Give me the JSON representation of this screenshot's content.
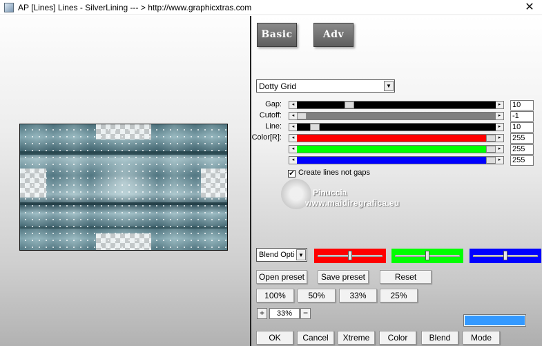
{
  "window": {
    "title": "AP [Lines]  Lines - SilverLining     --- > http://www.graphicxtras.com",
    "close_glyph": "✕"
  },
  "modes": {
    "basic_label": "Basic",
    "adv_label": "Adv"
  },
  "type_select": {
    "value": "Dotty Grid"
  },
  "sliders": [
    {
      "label": "Gap:",
      "value": "10",
      "color": "#000000",
      "fill": 0.25
    },
    {
      "label": "Cutoff:",
      "value": "-1",
      "color": "#808080",
      "fill": 0.0
    },
    {
      "label": "Line:",
      "value": "10",
      "color": "#000000",
      "fill": 0.07
    },
    {
      "label": "Color[R]:",
      "value": "255",
      "color": "#ff0000",
      "fill": 1.0
    },
    {
      "label": "",
      "value": "255",
      "color": "#00ff00",
      "fill": 1.0
    },
    {
      "label": "",
      "value": "255",
      "color": "#0000ff",
      "fill": 1.0
    }
  ],
  "checkbox": {
    "label": "Create lines not gaps",
    "checked": true
  },
  "watermark": {
    "name": "Pinuccia",
    "site": "www.maidiregrafica.eu"
  },
  "blend": {
    "select_value": "Blend Optic",
    "red_color": "#ff0000",
    "green_color": "#00ff00",
    "blue_color": "#0000ff",
    "red_level": 0.5,
    "green_level": 0.5,
    "blue_level": 0.5
  },
  "presets": {
    "open_label": "Open preset",
    "save_label": "Save preset",
    "reset_label": "Reset"
  },
  "zoom_buttons": [
    "100%",
    "50%",
    "33%",
    "25%"
  ],
  "zoom": {
    "plus": "+",
    "value": "33%",
    "minus": "−"
  },
  "swatch_color": "#3399ff",
  "bottom_buttons": [
    "OK",
    "Cancel",
    "Xtreme",
    "Color",
    "Blend",
    "Mode"
  ]
}
